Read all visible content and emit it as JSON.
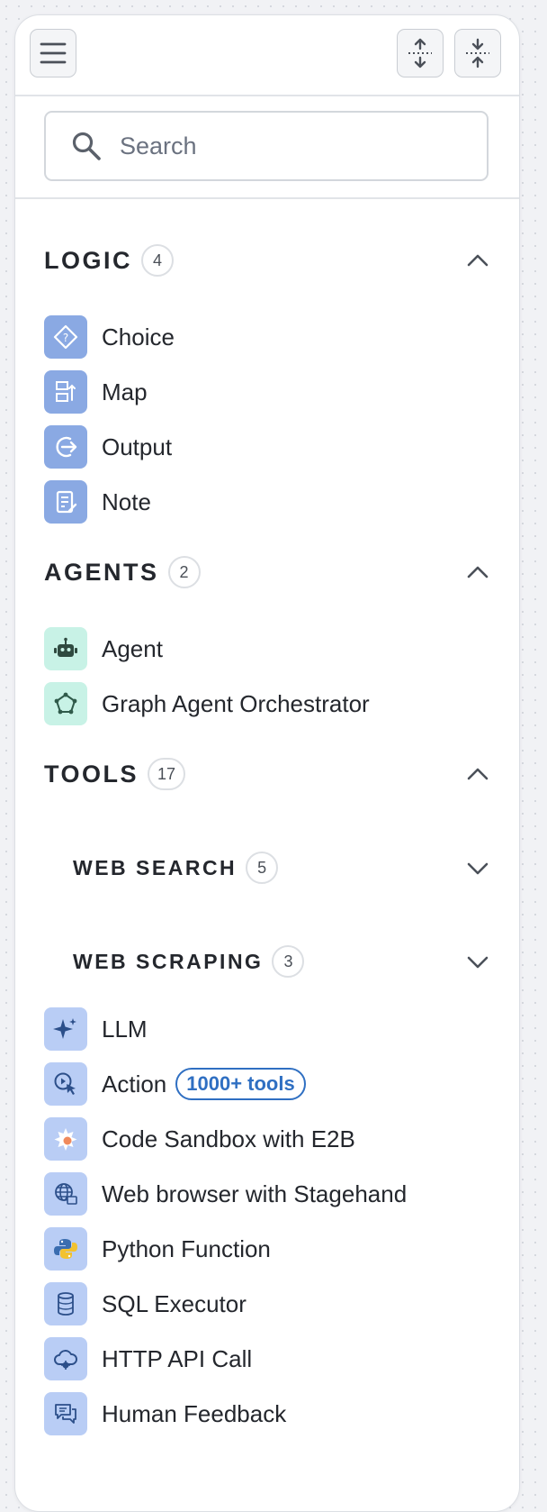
{
  "search": {
    "placeholder": "Search",
    "value": ""
  },
  "sections": {
    "logic": {
      "title": "LOGIC",
      "count": "4"
    },
    "agents": {
      "title": "AGENTS",
      "count": "2"
    },
    "tools": {
      "title": "TOOLS",
      "count": "17"
    },
    "web_search": {
      "title": "WEB SEARCH",
      "count": "5"
    },
    "web_scraping": {
      "title": "WEB SCRAPING",
      "count": "3"
    }
  },
  "logic_items": [
    "Choice",
    "Map",
    "Output",
    "Note"
  ],
  "agent_items": [
    "Agent",
    "Graph Agent Orchestrator"
  ],
  "tool_items": [
    "LLM",
    "Action",
    "Code Sandbox with E2B",
    "Web browser with Stagehand",
    "Python Function",
    "SQL Executor",
    "HTTP API Call",
    "Human Feedback"
  ],
  "action_badge": "1000+ tools",
  "icons": {
    "menu": "hamburger-icon",
    "expand": "expand-all-icon",
    "collapse": "collapse-all-icon",
    "search": "search-icon",
    "expanded": "chevron-up-icon",
    "collapsed": "chevron-down-icon",
    "logic": [
      "choice-icon",
      "map-icon",
      "output-icon",
      "note-icon"
    ],
    "agents": [
      "robot-icon",
      "graph-icon"
    ],
    "tools": [
      "sparkle-icon",
      "cursor-play-icon",
      "e2b-icon",
      "globe-browser-icon",
      "python-icon",
      "database-icon",
      "cloud-api-icon",
      "chat-feedback-icon"
    ]
  },
  "colors": {
    "logic_icon_bg": "#8aa9e3",
    "agent_icon_bg": "#c8f2e6",
    "tool_icon_bg": "#b9cdf5",
    "badge_accent": "#2f6fc2",
    "text": "#24272d"
  }
}
